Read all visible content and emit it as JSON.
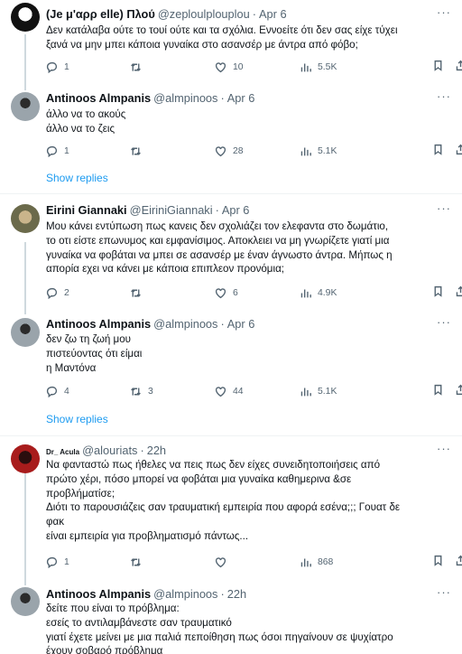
{
  "tweets": [
    {
      "name": "(Je μ'αρρ elle) Πλού",
      "handle": "@zeploulplouplou",
      "time": "Apr 6",
      "lines": [
        "Δεν κατάλαβα ούτε το τουί ούτε και τα σχόλια. Εννοείτε ότι δεν σας είχε τύχει",
        "ξανά να μην μπει κάποια γυναίκα στο ασανσέρ με άντρα από φόβο;"
      ],
      "replies": "1",
      "retweets": "",
      "likes": "10",
      "views": "5.5K"
    },
    {
      "name": "Antinoos Almpanis",
      "handle": "@almpinoos",
      "time": "Apr 6",
      "lines": [
        "άλλο να το ακούς",
        "άλλο να το ζεις"
      ],
      "replies": "1",
      "retweets": "",
      "likes": "28",
      "views": "5.1K"
    },
    {
      "name": "Eirini Giannaki",
      "handle": "@EiriniGiannaki",
      "time": "Apr 6",
      "lines": [
        "Μου κάνει εντύπωση πως κανεις δεν σχολιάζει τον ελεφαντα στο δωμάτιο,",
        "το οτι είστε επωνυμος και εμφανίσιμος. Αποκλειει να μη γνωρίζετε γιατί μια",
        "γυναίκα να φοβάται να μπει σε ασανσέρ με έναν άγνωστο άντρα. Μήπως η",
        "απορία εχει να κάνει με κάποια επιπλεον προνόμια;"
      ],
      "replies": "2",
      "retweets": "",
      "likes": "6",
      "views": "4.9K"
    },
    {
      "name": "Antinoos Almpanis",
      "handle": "@almpinoos",
      "time": "Apr 6",
      "lines": [
        "δεν ζω τη ζωή μου",
        "πιστεύοντας ότι είμαι",
        "η Μαντόνα"
      ],
      "replies": "4",
      "retweets": "3",
      "likes": "44",
      "views": "5.1K"
    },
    {
      "name": "Dr_ Acula",
      "handle": "@alouriats",
      "time": "22h",
      "lines": [
        "Να φανταστώ πως ήθελες να πεις πως δεν είχες συνειδητοποιήσεις από",
        "πρώτο χέρι, πόσο μπορεί να φοβάται μια γυναίκα καθημερινα &σε",
        "προβλήματίσε;",
        "Διότι το παρουσιάζεις σαν τραυματική εμπειρία που αφορά εσένα;;; Γουατ δε",
        "φακ",
        "είναι εμπειρία για προβληματισμό πάντως..."
      ],
      "replies": "1",
      "retweets": "",
      "likes": "",
      "views": "868"
    },
    {
      "name": "Antinoos Almpanis",
      "handle": "@almpinoos",
      "time": "22h",
      "lines": [
        "δείτε που είναι το πρόβλημα:",
        "εσείς το αντιλαμβάνεστε σαν τραυματικό",
        "γιατί έχετε μείνει με μια παλιά πεποίθηση πως όσοι πηγαίνουν σε ψυχίατρο",
        "έχουν σοβαρό πρόβλημα"
      ]
    }
  ],
  "show_replies_label": "Show replies",
  "more_glyph": "···",
  "icons": {
    "reply": "reply-icon",
    "retweet": "retweet-icon",
    "like": "heart-icon",
    "views": "views-bar-chart-icon",
    "bookmark": "bookmark-icon",
    "share": "share-icon"
  },
  "colors": {
    "link": "#1d9bf0",
    "secondary": "#536471",
    "text": "#0f1419",
    "divider": "#eff3f4"
  }
}
